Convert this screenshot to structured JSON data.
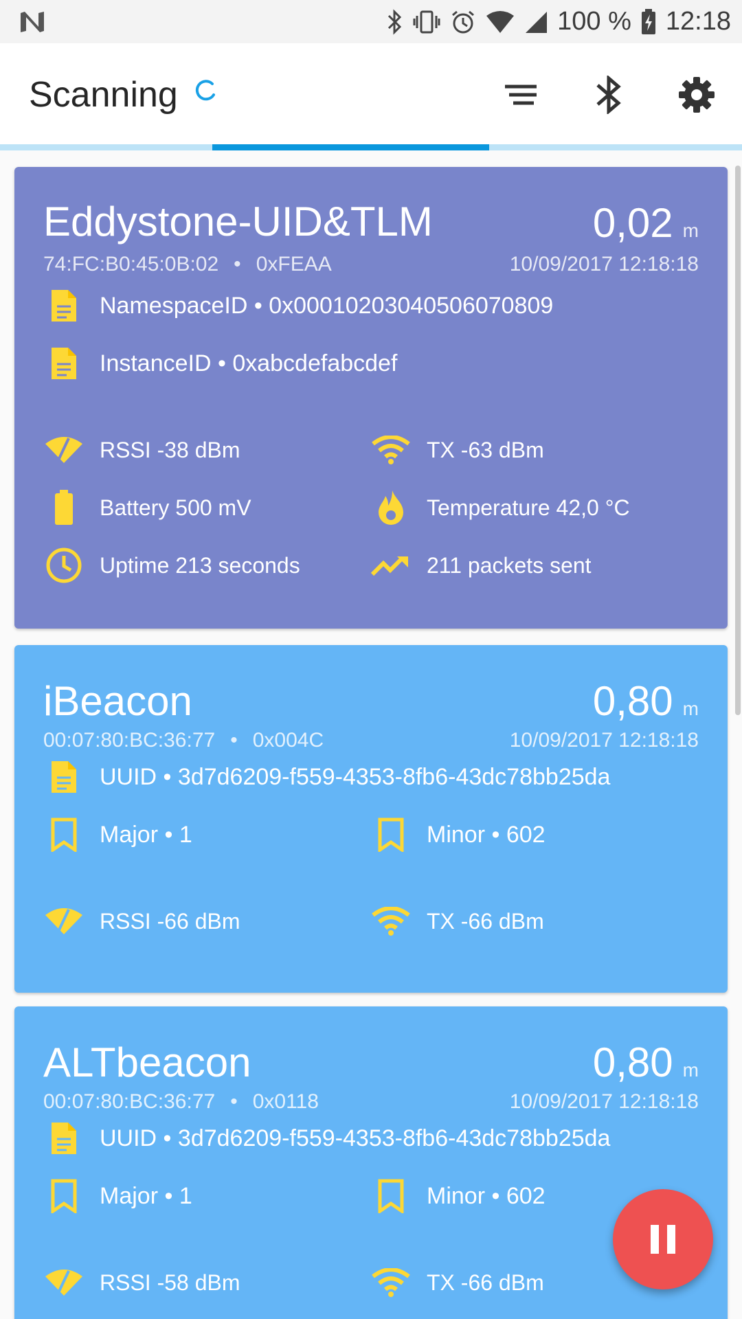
{
  "statusbar": {
    "battery": "100 %",
    "time": "12:18"
  },
  "appbar": {
    "title": "Scanning"
  },
  "progress": {
    "start": 0.286,
    "end": 0.659
  },
  "colors": {
    "eddystone_card": "#7985cb",
    "ibeacon_card": "#64b5f6",
    "icon_yellow": "#fdd835",
    "fab": "#ee5151",
    "accent": "#0a97dd"
  },
  "cards": [
    {
      "name": "Eddystone-UID&TLM",
      "distance": "0,02",
      "unit": "m",
      "address": "74:FC:B0:45:0B:02",
      "company": "0xFEAA",
      "timestamp": "10/09/2017 12:18:18",
      "rows": [
        {
          "icon": "document-icon",
          "text": "NamespaceID • 0x00010203040506070809"
        },
        {
          "icon": "document-icon",
          "text": "InstanceID • 0xabcdefabcdef"
        }
      ],
      "stats": [
        {
          "icon": "rssi-icon",
          "text": "RSSI -38 dBm"
        },
        {
          "icon": "wifi-icon",
          "text": "TX -63 dBm"
        },
        {
          "icon": "battery-icon",
          "text": "Battery 500 mV"
        },
        {
          "icon": "flame-icon",
          "text": "Temperature 42,0 °C"
        },
        {
          "icon": "clock-icon",
          "text": "Uptime 213 seconds"
        },
        {
          "icon": "trending-icon",
          "text": "211 packets sent"
        }
      ]
    },
    {
      "name": "iBeacon",
      "distance": "0,80",
      "unit": "m",
      "address": "00:07:80:BC:36:77",
      "company": "0x004C",
      "timestamp": "10/09/2017 12:18:18",
      "uuid": "UUID • 3d7d6209-f559-4353-8fb6-43dc78bb25da",
      "major": "Major • 1",
      "minor": "Minor • 602",
      "rssi": "RSSI -66 dBm",
      "tx": "TX -66 dBm"
    },
    {
      "name": "ALTbeacon",
      "distance": "0,80",
      "unit": "m",
      "address": "00:07:80:BC:36:77",
      "company": "0x0118",
      "timestamp": "10/09/2017 12:18:18",
      "uuid": "UUID • 3d7d6209-f559-4353-8fb6-43dc78bb25da",
      "major": "Major • 1",
      "minor": "Minor • 602",
      "rssi": "RSSI -58 dBm",
      "tx": "TX -66 dBm"
    }
  ]
}
